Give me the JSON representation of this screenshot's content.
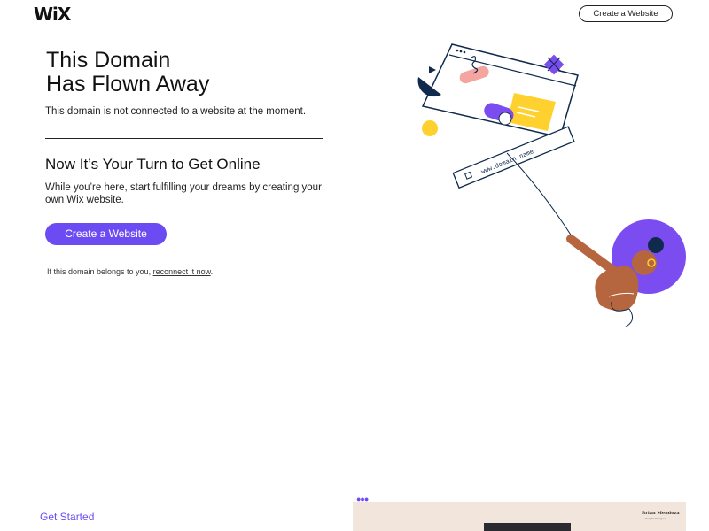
{
  "header": {
    "logo_text": "WiX",
    "create_button": "Create a Website"
  },
  "hero": {
    "title_line1": "This Domain",
    "title_line2": "Has Flown Away",
    "subtitle": "This domain is not connected to a website at the moment."
  },
  "section": {
    "title": "Now It’s Your Turn to Get Online",
    "body": "While you’re here, start fulfilling your dreams by creating your own Wix website.",
    "cta_label": "Create a Website",
    "reconnect_prefix": "If this domain belongs to you, ",
    "reconnect_link": "reconnect it now",
    "reconnect_suffix": "."
  },
  "illustration": {
    "url_text": "www.domain-name"
  },
  "footer": {
    "get_started": "Get Started",
    "preview_name": "Brian Mendoza",
    "preview_role": "Graphic Designer"
  },
  "colors": {
    "accent": "#6c4cf2",
    "yellow": "#ffd12e",
    "navy": "#0f2a4d",
    "pink": "#f5a5a0",
    "skin": "#b5663e"
  }
}
